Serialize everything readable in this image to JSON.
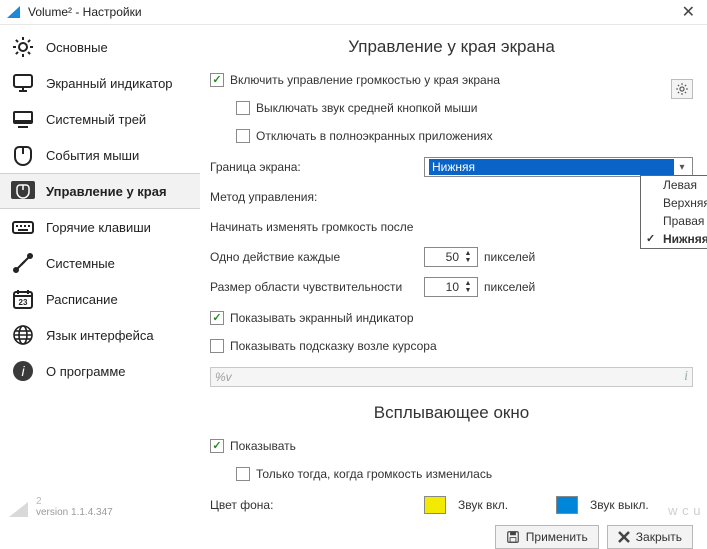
{
  "window": {
    "title": "Volume² - Настройки"
  },
  "sidebar": {
    "items": [
      {
        "label": "Основные"
      },
      {
        "label": "Экранный индикатор"
      },
      {
        "label": "Системный трей"
      },
      {
        "label": "События мыши"
      },
      {
        "label": "Управление у края"
      },
      {
        "label": "Горячие клавиши"
      },
      {
        "label": "Системные"
      },
      {
        "label": "Расписание"
      },
      {
        "label": "Язык интерфейса"
      },
      {
        "label": "О программе"
      }
    ]
  },
  "edge": {
    "heading": "Управление у края экрана",
    "enable": "Включить управление громкостью у края экрана",
    "mute_middle": "Выключать звук средней кнопкой мыши",
    "disable_fullscreen": "Отключать в полноэкранных приложениях",
    "border_label": "Граница экрана:",
    "border_selected": "Нижняя",
    "border_options": [
      "Левая",
      "Верхняя",
      "Правая",
      "Нижняя"
    ],
    "method_label": "Метод управления:",
    "start_after_label": "Начинать изменять громкость после",
    "one_action_label": "Одно действие каждые",
    "one_action_value": "50",
    "sens_label": "Размер области чувствительности",
    "sens_value": "10",
    "unit": "пикселей",
    "show_osd": "Показывать экранный индикатор",
    "show_hint": "Показывать подсказку возле курсора",
    "hint_placeholder": "%v"
  },
  "popup": {
    "heading": "Всплывающее окно",
    "show": "Показывать",
    "only_when": "Только тогда, когда громкость изменилась",
    "bgcolor_label": "Цвет фона:",
    "sound_on": "Звук вкл.",
    "sound_off": "Звук выкл.",
    "swatch_on": "#f2ea00",
    "swatch_off": "#0086d8"
  },
  "footer": {
    "apply": "Применить",
    "close": "Закрыть",
    "version": "version 1.1.4.347",
    "version_num": "2"
  },
  "watermark": "w   c   u"
}
